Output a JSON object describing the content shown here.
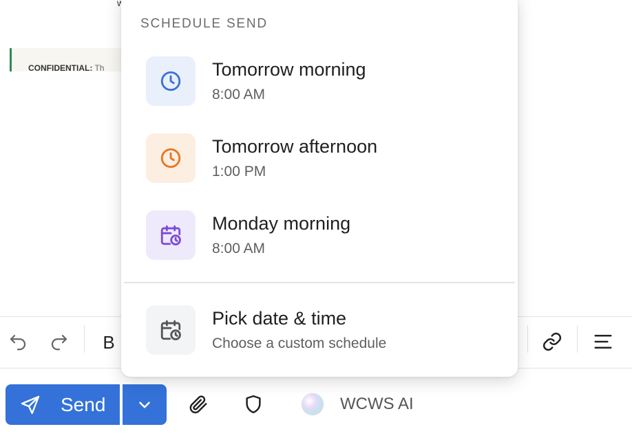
{
  "background": {
    "top_fragment": "w",
    "confidential_label": "CONFIDENTIAL:",
    "confidential_text": " Th"
  },
  "toolbar": {
    "bold_label": "B"
  },
  "bottom_bar": {
    "send_label": "Send",
    "ai_label": "WCWS AI"
  },
  "schedule_popup": {
    "title": "SCHEDULE SEND",
    "options": [
      {
        "title": "Tomorrow morning",
        "subtitle": "8:00 AM",
        "icon": "clock-icon",
        "icon_color": "#3b6fd8",
        "tile_color": "#e9f0fc"
      },
      {
        "title": "Tomorrow afternoon",
        "subtitle": "1:00 PM",
        "icon": "clock-icon",
        "icon_color": "#e8731f",
        "tile_color": "#fdeee2"
      },
      {
        "title": "Monday morning",
        "subtitle": "8:00 AM",
        "icon": "calendar-clock-icon",
        "icon_color": "#7a4bd6",
        "tile_color": "#efe9fc"
      }
    ],
    "custom": {
      "title": "Pick date & time",
      "subtitle": "Choose a custom schedule",
      "icon": "calendar-clock-icon",
      "icon_color": "#555555",
      "tile_color": "#f3f4f6"
    }
  },
  "colors": {
    "accent": "#3472d9",
    "confidential_border": "#2e8b57"
  }
}
